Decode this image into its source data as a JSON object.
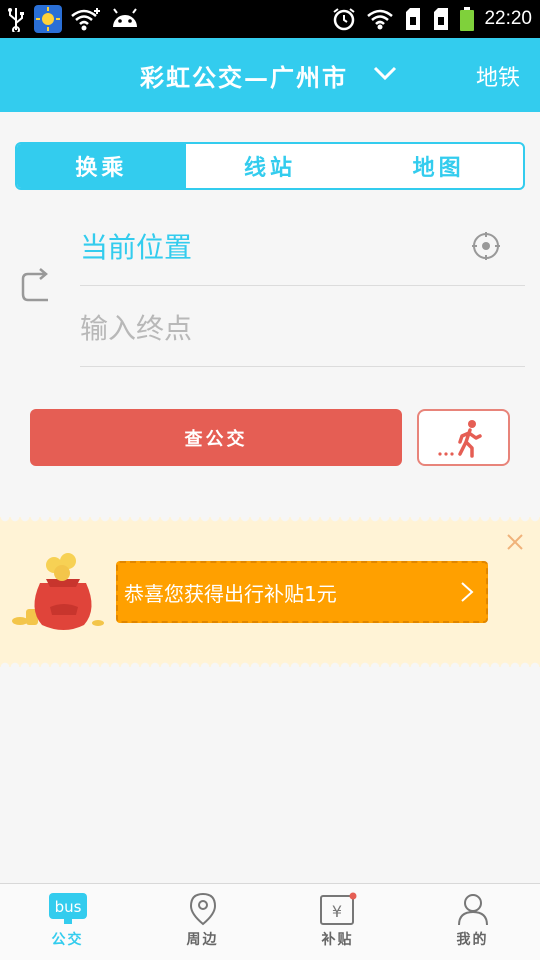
{
  "status_bar": {
    "time": "22:20",
    "left_icons": [
      "usb-icon",
      "weather-icon",
      "wifi-plus-icon",
      "android-icon"
    ],
    "right_icons": [
      "alarm-icon",
      "wifi-icon",
      "sim1-icon",
      "sim2-icon",
      "battery-icon"
    ]
  },
  "header": {
    "title": "彩虹公交—广州市",
    "subway_label": "地铁"
  },
  "tabs": [
    {
      "label": "换乘",
      "active": true
    },
    {
      "label": "线站",
      "active": false
    },
    {
      "label": "地图",
      "active": false
    }
  ],
  "route": {
    "start_text": "当前位置",
    "end_placeholder": "输入终点"
  },
  "buttons": {
    "search_label": "查公交"
  },
  "promo": {
    "text": "恭喜您获得出行补贴1元"
  },
  "bottom_nav": [
    {
      "label": "公交",
      "icon": "bus-icon",
      "active": true
    },
    {
      "label": "周边",
      "icon": "location-pin-icon",
      "active": false
    },
    {
      "label": "补贴",
      "icon": "yuan-card-icon",
      "active": false
    },
    {
      "label": "我的",
      "icon": "person-icon",
      "active": false
    }
  ],
  "colors": {
    "accent": "#33ccee",
    "search_button": "#e55e54",
    "promo": "#ffa000",
    "banner_bg": "#fff3d6"
  }
}
